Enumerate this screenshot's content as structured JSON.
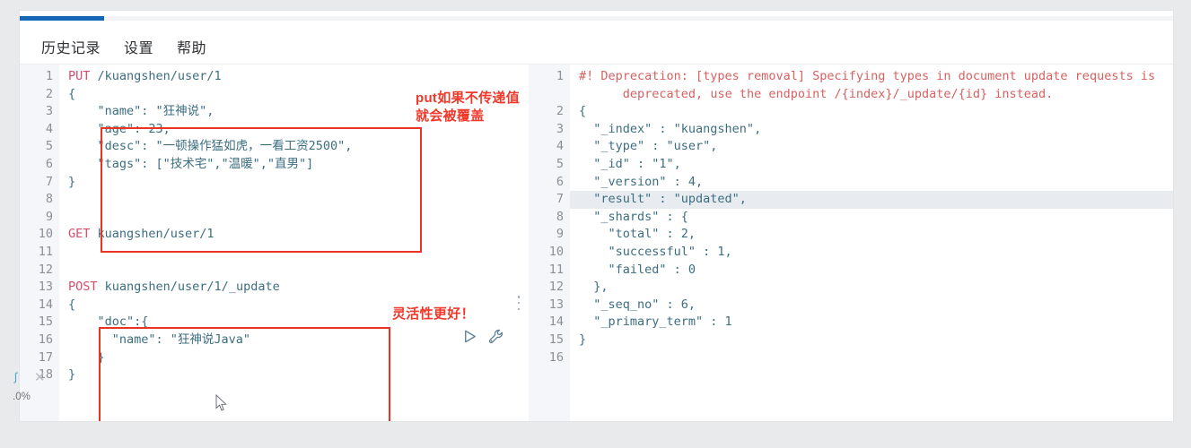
{
  "window": {
    "title": "Kibana Dev Tools Console"
  },
  "menu": {
    "items": [
      {
        "label": "历史记录",
        "name": "menu-history"
      },
      {
        "label": "设置",
        "name": "menu-settings"
      },
      {
        "label": "帮助",
        "name": "menu-help"
      }
    ]
  },
  "editor": {
    "pane_name": "request-editor",
    "line_numbers": [
      "1",
      "2",
      "3",
      "4",
      "5",
      "6",
      "7",
      "8",
      "9",
      "10",
      "11",
      "12",
      "13",
      "14",
      "15",
      "16",
      "17",
      "18"
    ],
    "fold_markers": {
      "2": "▾",
      "7": "▴",
      "14": "▾",
      "15": "▾",
      "17": "▴",
      "18": "▴"
    },
    "lines": [
      {
        "n": 1,
        "method": "PUT",
        "rest": " /kuangshen/user/1"
      },
      {
        "n": 2,
        "text": "{"
      },
      {
        "n": 3,
        "text": "    \"name\": \"狂神说\","
      },
      {
        "n": 4,
        "text": "    \"age\": 23,"
      },
      {
        "n": 5,
        "text": "    \"desc\": \"一顿操作猛如虎，一看工资2500\","
      },
      {
        "n": 6,
        "text": "    \"tags\": [\"技术宅\",\"温暖\",\"直男\"]"
      },
      {
        "n": 7,
        "text": "}"
      },
      {
        "n": 8,
        "text": ""
      },
      {
        "n": 9,
        "text": ""
      },
      {
        "n": 10,
        "method": "GET",
        "rest": " kuangshen/user/1"
      },
      {
        "n": 11,
        "text": ""
      },
      {
        "n": 12,
        "text": ""
      },
      {
        "n": 13,
        "method": "POST",
        "rest": " kuangshen/user/1/_update"
      },
      {
        "n": 14,
        "text": "{"
      },
      {
        "n": 15,
        "text": "    \"doc\":{"
      },
      {
        "n": 16,
        "text": "      \"name\": \"狂神说Java\""
      },
      {
        "n": 17,
        "text": "    }"
      },
      {
        "n": 18,
        "text": "}"
      }
    ],
    "actions": {
      "run_label": "play-button",
      "wrench_label": "wrench-button"
    }
  },
  "output": {
    "pane_name": "response-output",
    "line_numbers": [
      "1",
      "2",
      "3",
      "4",
      "5",
      "6",
      "7",
      "8",
      "9",
      "10",
      "11",
      "12",
      "13",
      "14",
      "15",
      "16"
    ],
    "fold_markers": {
      "2": "▾",
      "8": "▾",
      "12": "▴",
      "15": "▴"
    },
    "highlighted_line": 7,
    "lines": [
      {
        "n": 1,
        "warn": "#! Deprecation: [types removal] Specifying types in document update requests is",
        "warn2": "deprecated, use the endpoint /{index}/_update/{id} instead."
      },
      {
        "n": 2,
        "text": "{"
      },
      {
        "n": 3,
        "text": "  \"_index\" : \"kuangshen\","
      },
      {
        "n": 4,
        "text": "  \"_type\" : \"user\","
      },
      {
        "n": 5,
        "text": "  \"_id\" : \"1\","
      },
      {
        "n": 6,
        "text": "  \"_version\" : 4,"
      },
      {
        "n": 7,
        "text": "  \"result\" : \"updated\","
      },
      {
        "n": 8,
        "text": "  \"_shards\" : {"
      },
      {
        "n": 9,
        "text": "    \"total\" : 2,"
      },
      {
        "n": 10,
        "text": "    \"successful\" : 1,"
      },
      {
        "n": 11,
        "text": "    \"failed\" : 0"
      },
      {
        "n": 12,
        "text": "  },"
      },
      {
        "n": 13,
        "text": "  \"_seq_no\" : 6,"
      },
      {
        "n": 14,
        "text": "  \"_primary_term\" : 1"
      },
      {
        "n": 15,
        "text": "}"
      },
      {
        "n": 16,
        "text": ""
      }
    ]
  },
  "annotations": {
    "put_note": "put如果不传递值\n就会被覆盖",
    "post_note": "灵活性更好！"
  },
  "overlay": {
    "percent_label": ".0%",
    "close_label": "✕",
    "glyph": "ʃ"
  },
  "colors": {
    "accent_blue": "#1667b5",
    "annotation_red": "#f0392b",
    "box_red": "#ec3223",
    "method_pink": "#dd4b6a",
    "json_teal": "#3c6e80",
    "warn_red": "#d86060",
    "highlight_row": "#e8ecf1"
  }
}
